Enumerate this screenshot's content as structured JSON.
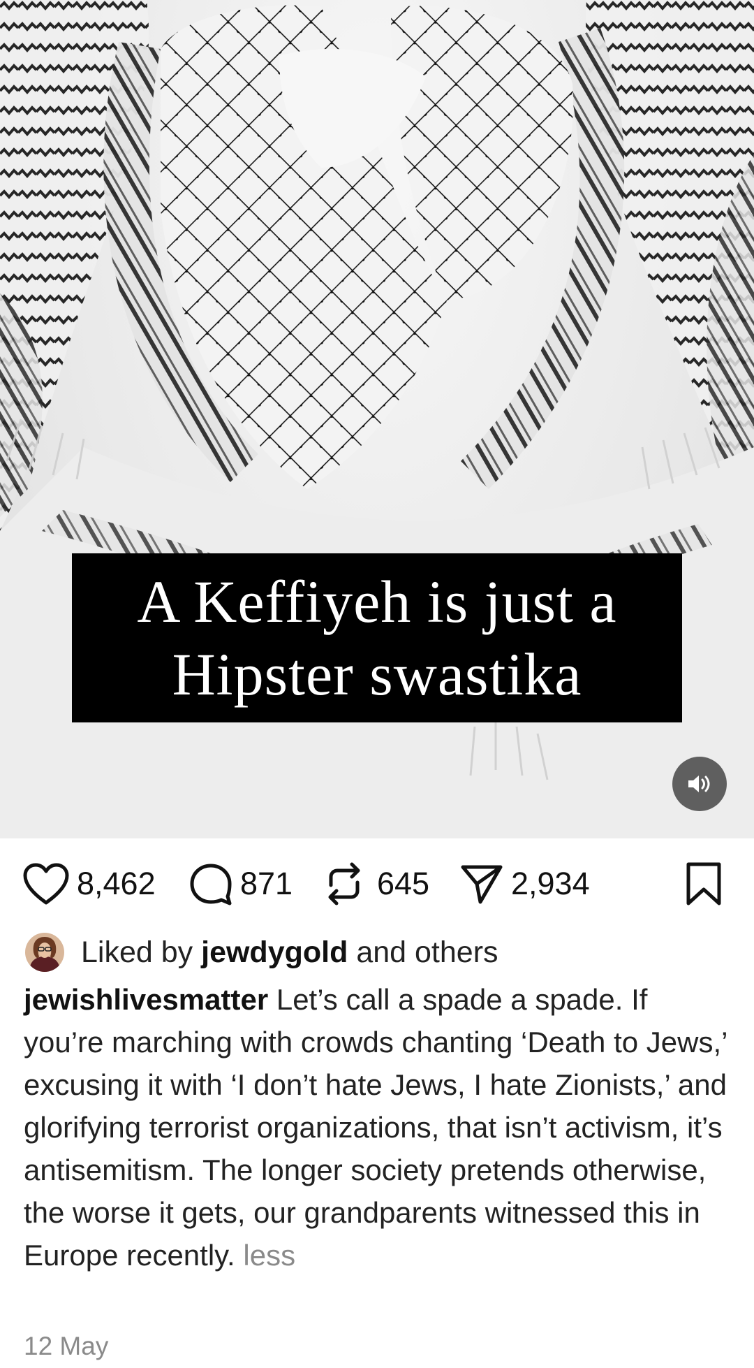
{
  "post": {
    "image_overlay_lines": [
      "A Keffiyeh is just a",
      "Hipster swastika"
    ],
    "sound_button_icon": "volume-icon"
  },
  "actions": {
    "likes": "8,462",
    "comments": "871",
    "reposts": "645",
    "shares": "2,934"
  },
  "liked_by": {
    "prefix": "Liked by",
    "username": "jewdygold",
    "suffix": "and others"
  },
  "caption": {
    "username": "jewishlivesmatter",
    "text": "Let’s call a spade a spade. If you’re marching with crowds chanting ‘Death to Jews,’ excusing it with ‘I don’t hate Jews, I hate Zionists,’ and glorifying terrorist organizations, that isn’t activism, it’s antisemitism. The longer society pretends otherwise, the worse it gets, our grandparents witnessed this in Europe recently.",
    "less_label": "less"
  },
  "date": "12 May",
  "colors": {
    "background": "#ffffff",
    "text": "#111111",
    "muted": "#8a8a8a",
    "overlay_box": "#000000"
  }
}
